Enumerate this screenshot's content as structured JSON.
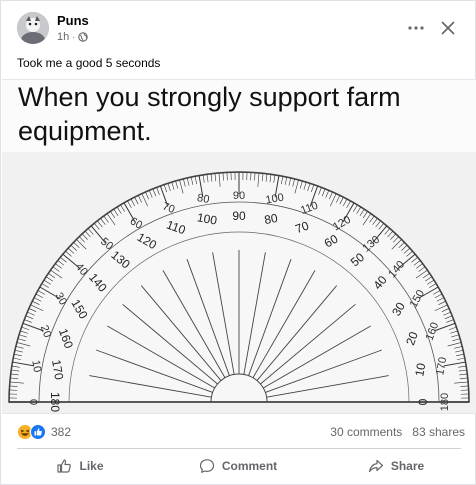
{
  "post": {
    "author": "Puns",
    "time": "1h",
    "separator": "·",
    "caption": "Took me a good 5 seconds",
    "meme_text": "When you strongly support farm equipment."
  },
  "protractor": {
    "outer_scale": [
      "0",
      "10",
      "20",
      "30",
      "40",
      "50",
      "60",
      "70",
      "80",
      "90",
      "100",
      "110",
      "120",
      "130",
      "140",
      "150",
      "160",
      "170",
      "180"
    ],
    "inner_scale": [
      "180",
      "170",
      "160",
      "150",
      "140",
      "130",
      "120",
      "110",
      "100",
      "90",
      "80",
      "70",
      "60",
      "50",
      "40",
      "30",
      "20",
      "10",
      "0"
    ]
  },
  "stats": {
    "reaction_count": "382",
    "comments": "30 comments",
    "shares": "83 shares"
  },
  "actions": {
    "like": "Like",
    "comment": "Comment",
    "share": "Share"
  },
  "icons": {
    "more": "more-options-icon",
    "close": "close-icon",
    "globe": "globe-icon",
    "haha": "haha-reaction-icon",
    "like_reaction": "like-reaction-icon",
    "like": "thumbs-up-icon",
    "comment": "comment-bubble-icon",
    "share": "share-arrow-icon"
  },
  "colors": {
    "secondary_text": "#65676b",
    "like_blue": "#1877f2",
    "haha_yellow": "#f7b125",
    "divider": "#ced0d4"
  }
}
